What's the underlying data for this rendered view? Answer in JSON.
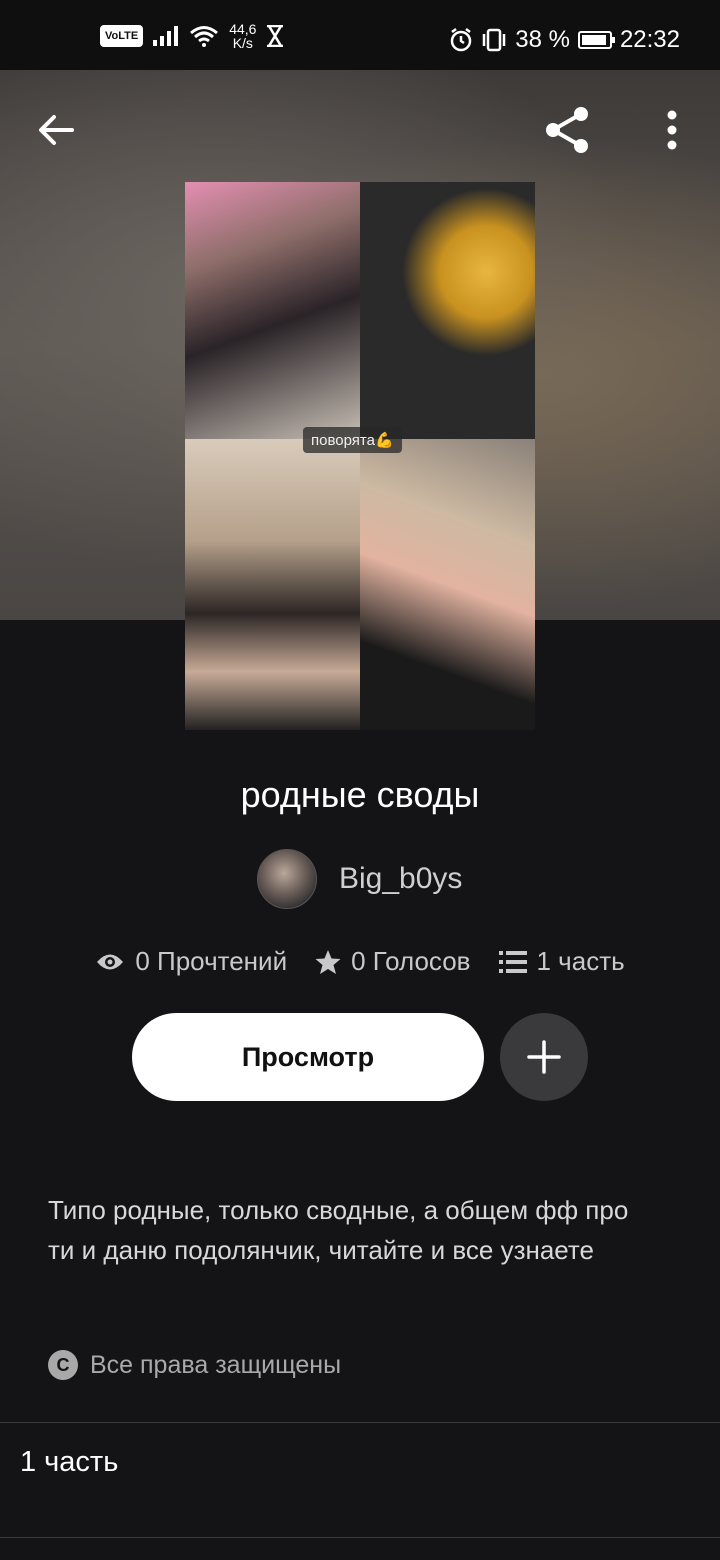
{
  "status_bar": {
    "volte": "VoLTE",
    "speed_value": "44,6",
    "speed_unit": "K/s",
    "battery_text": "38 %",
    "battery_level_percent": 38,
    "time": "22:32"
  },
  "toolbar": {
    "back_icon": "arrow-left-icon",
    "share_icon": "share-icon",
    "more_icon": "more-vertical-icon"
  },
  "cover": {
    "caption": "поворята💪"
  },
  "story": {
    "title": "родные своды",
    "author": "Big_b0ys",
    "reads": "0 Прочтений",
    "votes": "0 Голосов",
    "parts": "1 часть",
    "read_button": "Просмотр",
    "description": "Типо родные, только сводные, а общем фф про ти и даню подолянчик, читайте и все узнаете",
    "rights": "Все права защищены"
  },
  "table_of_contents": {
    "items": [
      {
        "label": "1 часть"
      }
    ]
  },
  "colors": {
    "background": "#141315",
    "button_primary": "#ffffff",
    "button_secondary": "#3a393c"
  }
}
